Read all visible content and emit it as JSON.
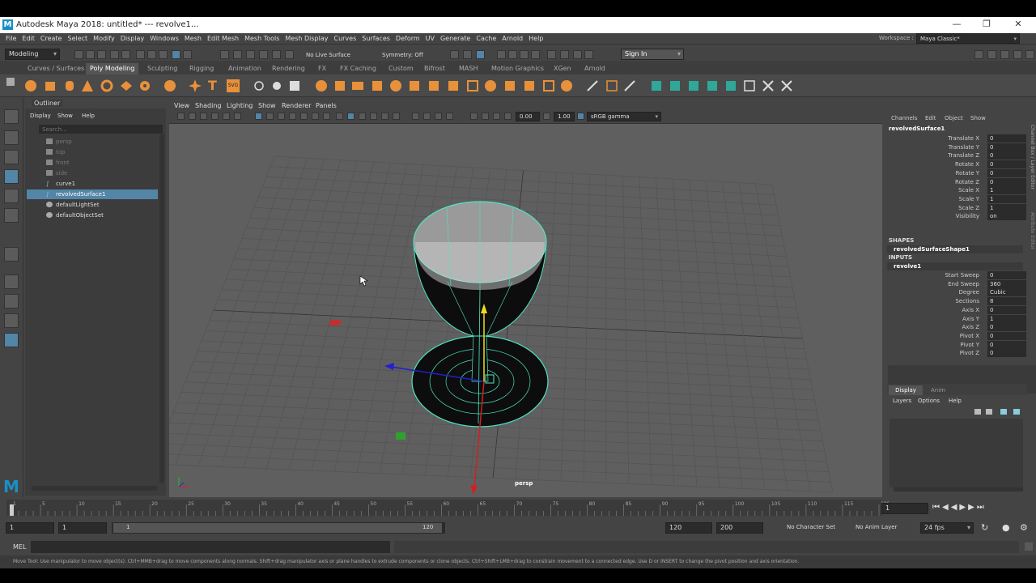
{
  "window": {
    "title": "Autodesk Maya 2018: untitled*   ---   revolve1..."
  },
  "menu": [
    "File",
    "Edit",
    "Create",
    "Select",
    "Modify",
    "Display",
    "Windows",
    "Mesh",
    "Edit Mesh",
    "Mesh Tools",
    "Mesh Display",
    "Curves",
    "Surfaces",
    "Deform",
    "UV",
    "Generate",
    "Cache",
    "Arnold",
    "Help"
  ],
  "workspace": {
    "label": "Workspace :",
    "value": "Maya Classic*"
  },
  "status": {
    "mode": "Modeling",
    "live": "No Live Surface",
    "symmetry": "Symmetry: Off",
    "signin": "Sign In"
  },
  "shelf_tabs": [
    "Curves / Surfaces",
    "Poly Modeling",
    "Sculpting",
    "Rigging",
    "Animation",
    "Rendering",
    "FX",
    "FX Caching",
    "Custom",
    "Bifrost",
    "MASH",
    "Motion Graphics",
    "XGen",
    "Arnold"
  ],
  "shelf_active": "Poly Modeling",
  "outliner": {
    "title": "Outliner",
    "menu": [
      "Display",
      "Show",
      "Help"
    ],
    "search_placeholder": "Search...",
    "items": [
      "persp",
      "top",
      "front",
      "side",
      "curve1",
      "revolvedSurface1",
      "defaultLightSet",
      "defaultObjectSet"
    ],
    "selected": "revolvedSurface1"
  },
  "viewport": {
    "menu": [
      "View",
      "Shading",
      "Lighting",
      "Show",
      "Renderer",
      "Panels"
    ],
    "field1": "0.00",
    "field2": "1.00",
    "colorspace": "sRGB gamma",
    "camera": "persp"
  },
  "channel_box": {
    "menu": [
      "Channels",
      "Edit",
      "Object",
      "Show"
    ],
    "object": "revolvedSurface1",
    "attrs": [
      {
        "name": "Translate X",
        "value": "0"
      },
      {
        "name": "Translate Y",
        "value": "0"
      },
      {
        "name": "Translate Z",
        "value": "0"
      },
      {
        "name": "Rotate X",
        "value": "0"
      },
      {
        "name": "Rotate Y",
        "value": "0"
      },
      {
        "name": "Rotate Z",
        "value": "0"
      },
      {
        "name": "Scale X",
        "value": "1"
      },
      {
        "name": "Scale Y",
        "value": "1"
      },
      {
        "name": "Scale Z",
        "value": "1"
      },
      {
        "name": "Visibility",
        "value": "on"
      }
    ],
    "shapes_label": "SHAPES",
    "shape": "revolvedSurfaceShape1",
    "inputs_label": "INPUTS",
    "input": "revolve1",
    "input_attrs": [
      {
        "name": "Start Sweep",
        "value": "0"
      },
      {
        "name": "End Sweep",
        "value": "360"
      },
      {
        "name": "Degree",
        "value": "Cubic"
      },
      {
        "name": "Sections",
        "value": "8"
      },
      {
        "name": "Axis X",
        "value": "0"
      },
      {
        "name": "Axis Y",
        "value": "1"
      },
      {
        "name": "Axis Z",
        "value": "0"
      },
      {
        "name": "Pivot X",
        "value": "0"
      },
      {
        "name": "Pivot Y",
        "value": "0"
      },
      {
        "name": "Pivot Z",
        "value": "0"
      }
    ],
    "side_tab1": "Channel Box / Layer Editor",
    "side_tab2": "Attribute Editor"
  },
  "layer_editor": {
    "tabs": [
      "Display",
      "Anim"
    ],
    "menu": [
      "Layers",
      "Options",
      "Help"
    ]
  },
  "timeline": {
    "ticks": [
      "1",
      "5",
      "10",
      "15",
      "20",
      "25",
      "30",
      "35",
      "40",
      "45",
      "50",
      "55",
      "60",
      "65",
      "70",
      "75",
      "80",
      "85",
      "90",
      "95",
      "100",
      "105",
      "110",
      "115",
      "120"
    ],
    "current": "1"
  },
  "range": {
    "start": "1",
    "inner_start": "1",
    "slider_start": "1",
    "slider_end": "120",
    "end": "120",
    "max": "200",
    "char_set": "No Character Set",
    "anim_layer": "No Anim Layer",
    "fps": "24 fps"
  },
  "mel": {
    "label": "MEL"
  },
  "help_line": "Move Tool: Use manipulator to move object(s). Ctrl+MMB+drag to move components along normals. Shift+drag manipulator axis or plane handles to extrude components or clone objects. Ctrl+Shift+LMB+drag to constrain movement to a connected edge. Use D or INSERT to change the pivot position and axis orientation."
}
